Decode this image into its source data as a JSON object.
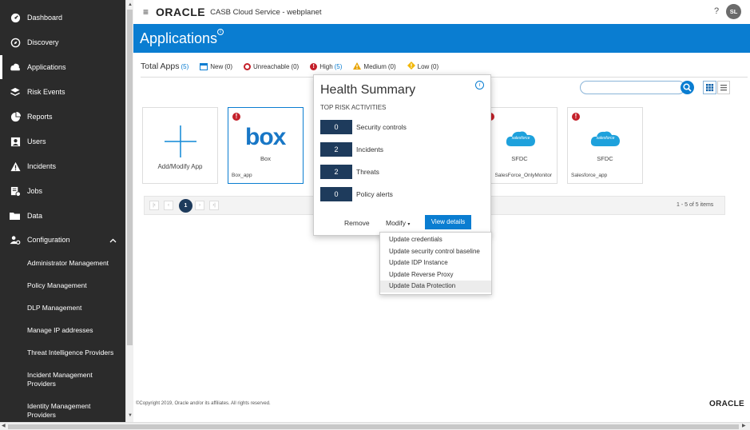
{
  "sidebar": {
    "items": [
      {
        "label": "Dashboard",
        "icon": "dashboard-icon"
      },
      {
        "label": "Discovery",
        "icon": "discovery-icon"
      },
      {
        "label": "Applications",
        "icon": "applications-icon"
      },
      {
        "label": "Risk Events",
        "icon": "risk-events-icon"
      },
      {
        "label": "Reports",
        "icon": "reports-icon"
      },
      {
        "label": "Users",
        "icon": "users-icon"
      },
      {
        "label": "Incidents",
        "icon": "incidents-icon"
      },
      {
        "label": "Jobs",
        "icon": "jobs-icon"
      },
      {
        "label": "Data",
        "icon": "data-icon"
      },
      {
        "label": "Configuration",
        "icon": "configuration-icon"
      }
    ],
    "config_sub": [
      "Administrator Management",
      "Policy Management",
      "DLP Management",
      "Manage IP addresses",
      "Threat Intelligence Providers",
      "Incident Management Providers",
      "Identity Management Providers"
    ]
  },
  "header": {
    "brand": "ORACLE",
    "service": "CASB Cloud Service - webplanet",
    "help": "?",
    "avatar": "SL"
  },
  "page": {
    "title": "Applications",
    "info": "i"
  },
  "filters": {
    "total_label": "Total Apps",
    "total_count": "(5)",
    "new_label": "New",
    "new_count": "(0)",
    "unreachable_label": "Unreachable",
    "unreachable_count": "(0)",
    "high_label": "High",
    "high_count": "(5)",
    "medium_label": "Medium",
    "medium_count": "(0)",
    "low_label": "Low",
    "low_count": "(0)"
  },
  "cards": {
    "add_label": "Add/Modify App",
    "box": {
      "logo": "box",
      "name": "Box",
      "instance": "Box_app"
    },
    "sfdc1": {
      "name": "SFDC",
      "instance": "SalesForce_OnlyMonitor"
    },
    "sfdc2": {
      "name": "SFDC",
      "instance": "Salesforce_app"
    },
    "salesforce_logo": "salesforce"
  },
  "pager": {
    "current": "1",
    "summary": "1 - 5 of 5 items"
  },
  "popover": {
    "title": "Health Summary",
    "subtitle": "TOP RISK ACTIVITIES",
    "metrics": [
      {
        "value": "0",
        "label": "Security controls"
      },
      {
        "value": "2",
        "label": "Incidents"
      },
      {
        "value": "2",
        "label": "Threats"
      },
      {
        "value": "0",
        "label": "Policy alerts"
      }
    ],
    "remove": "Remove",
    "modify": "Modify",
    "view": "View details",
    "info": "i"
  },
  "menu": {
    "items": [
      "Update credentials",
      "Update security control baseline",
      "Update IDP Instance",
      "Update Reverse Proxy",
      "Update Data Protection"
    ]
  },
  "footer": {
    "copyright": "©Copyright 2019, Oracle and/or its affiliates. All rights reserved.",
    "brand": "ORACLE"
  },
  "colors": {
    "accent": "#0a7dd1",
    "sidebar": "#2b2b2b",
    "metric_box": "#1e3b5c",
    "error": "#c4202a",
    "warning": "#e8a400",
    "salesforce": "#1ea1dc"
  }
}
